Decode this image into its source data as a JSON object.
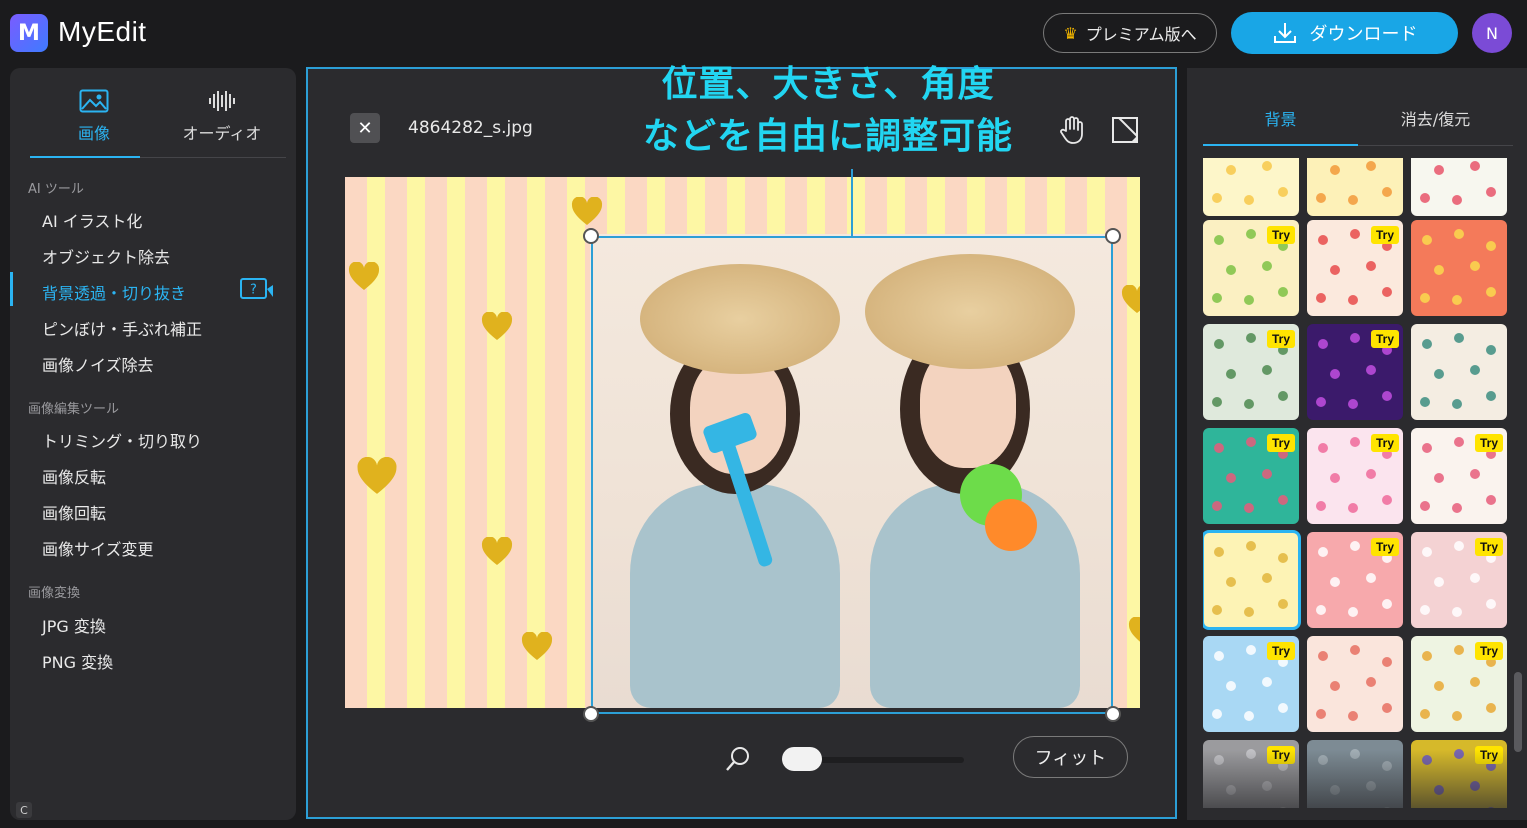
{
  "topbar": {
    "logo_letter": "M",
    "brand": "MyEdit",
    "premium_label": "プレミアム版へ",
    "download_label": "ダウンロード",
    "avatar_initial": "N"
  },
  "sidebar": {
    "tabs": [
      {
        "label": "画像",
        "icon": "image-icon",
        "active": true
      },
      {
        "label": "オーディオ",
        "icon": "audio-wave-icon",
        "active": false
      }
    ],
    "groups": [
      {
        "title": "AI ツール",
        "items": [
          "AI イラスト化",
          "オブジェクト除去",
          "背景透過・切り抜き",
          "ピンぼけ・手ぶれ補正",
          "画像ノイズ除去"
        ]
      },
      {
        "title": "画像編集ツール",
        "items": [
          "トリミング・切り取り",
          "画像反転",
          "画像回転",
          "画像サイズ変更"
        ]
      },
      {
        "title": "画像変換",
        "items": [
          "JPG 変換",
          "PNG 変換"
        ]
      }
    ],
    "active_item": "背景透過・切り抜き",
    "corner_badge": "C"
  },
  "editor": {
    "filename": "4864282_s.jpg",
    "annotation_line1": "位置、大きさ、角度",
    "annotation_line2": "などを自由に調整可能",
    "fit_label": "フィット",
    "zoom_level": 0.0
  },
  "right_panel": {
    "tabs": [
      {
        "label": "背景",
        "active": true
      },
      {
        "label": "消去/復元",
        "active": false
      }
    ],
    "try_label": "Try",
    "selected_tile": 12,
    "tiles": [
      {
        "try": false,
        "bg": "#fdf6c9",
        "dot": "#f7c84a"
      },
      {
        "try": false,
        "bg": "#fdf1b8",
        "dot": "#f29a3a"
      },
      {
        "try": false,
        "bg": "#f7f7ef",
        "dot": "#e8556a"
      },
      {
        "try": true,
        "bg": "#fbf0c2",
        "dot": "#7dc244"
      },
      {
        "try": true,
        "bg": "#fbe9dd",
        "dot": "#e84b4b"
      },
      {
        "try": false,
        "bg": "#f47a5a",
        "dot": "#f9d94e"
      },
      {
        "try": true,
        "bg": "#dfe9dc",
        "dot": "#4d8a50"
      },
      {
        "try": true,
        "bg": "#3b1a6b",
        "dot": "#c24fe0"
      },
      {
        "try": false,
        "bg": "#f4ede2",
        "dot": "#3c8d80"
      },
      {
        "try": true,
        "bg": "#2fb59a",
        "dot": "#e85a7a"
      },
      {
        "try": true,
        "bg": "#fbe4ee",
        "dot": "#ef6a9a"
      },
      {
        "try": true,
        "bg": "#faf3ee",
        "dot": "#e65c7a"
      },
      {
        "try": false,
        "bg": "#fdf3b5",
        "dot": "#e2b53c"
      },
      {
        "try": true,
        "bg": "#f7a9ac",
        "dot": "#ffffff"
      },
      {
        "try": true,
        "bg": "#f4d2d3",
        "dot": "#ffffff"
      },
      {
        "try": true,
        "bg": "#a9d8f4",
        "dot": "#ffffff"
      },
      {
        "try": false,
        "bg": "#fae5dc",
        "dot": "#e67062"
      },
      {
        "try": true,
        "bg": "#eef4e2",
        "dot": "#e7a834"
      },
      {
        "try": true,
        "bg": "#9b9b9e",
        "dot": "#c9c9cc"
      },
      {
        "try": false,
        "bg": "#7d8b94",
        "dot": "#a8b4bb"
      },
      {
        "try": true,
        "bg": "#d6b92a",
        "dot": "#6a58c8"
      }
    ]
  },
  "colors": {
    "accent": "#2bb4f2",
    "download": "#19a6e6",
    "annotation": "#22d6f2",
    "avatar": "#7b4bd6"
  }
}
